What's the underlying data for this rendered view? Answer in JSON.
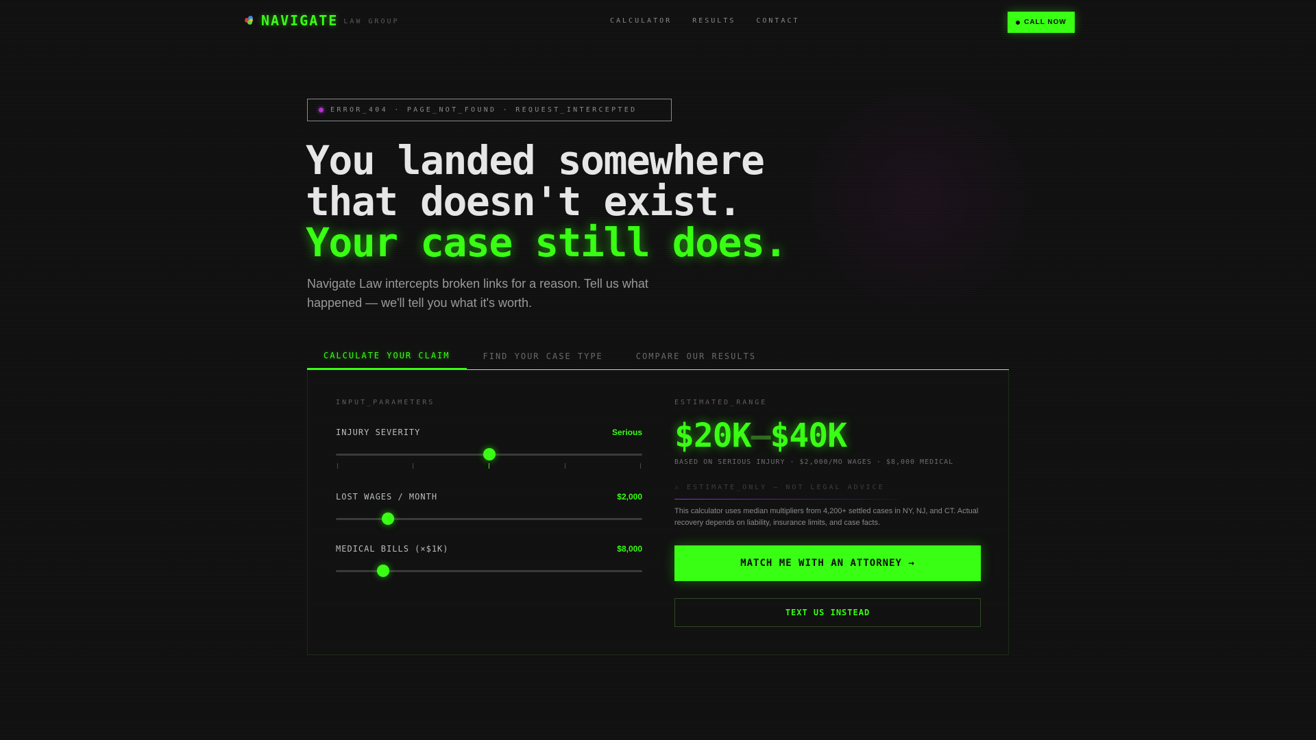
{
  "nav": {
    "brand": "NAVIGATE",
    "brand_sub": "LAW GROUP",
    "links": [
      "CALCULATOR",
      "RESULTS",
      "CONTACT"
    ],
    "call_label": "CALL NOW"
  },
  "hero": {
    "badge": "ERROR_404 · PAGE_NOT_FOUND · REQUEST_INTERCEPTED",
    "line1": "You landed somewhere",
    "line2": "that doesn't exist.",
    "line3": "Your case still does.",
    "subtext": "Navigate Law intercepts broken links for a reason. Tell us what happened — we'll tell you what it's worth."
  },
  "tabs": [
    "CALCULATE YOUR CLAIM",
    "FIND YOUR CASE TYPE",
    "COMPARE OUR RESULTS"
  ],
  "calculator": {
    "input_label": "INPUT_PARAMETERS",
    "sliders": [
      {
        "label": "INJURY SEVERITY",
        "value": "Serious",
        "level": 0.5
      },
      {
        "label": "LOST WAGES / MONTH",
        "value": "$2,000",
        "level": 0.17
      },
      {
        "label": "MEDICAL BILLS (×$1K)",
        "value": "$8,000",
        "level": 0.155
      }
    ]
  },
  "estimate": {
    "label": "ESTIMATED_RANGE",
    "low": "$20K",
    "sep": "—",
    "high": "$40K",
    "basis": "BASED ON SERIOUS INJURY · $2,000/MO WAGES · $8,000 MEDICAL",
    "disclaimer": "⚠ ESTIMATE_ONLY — NOT LEGAL ADVICE",
    "note": "This calculator uses median multipliers from 4,200+ settled cases in NY, NJ, and CT. Actual recovery depends on liability, insurance limits, and case facts.",
    "match_label": "MATCH ME WITH AN ATTORNEY →",
    "text_label": "TEXT US INSTEAD"
  },
  "colors": {
    "accent": "#39ff14",
    "background": "#101010",
    "error_dot": "#b030d0"
  }
}
